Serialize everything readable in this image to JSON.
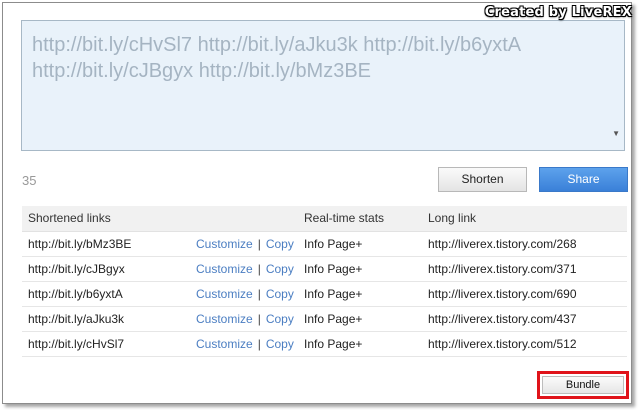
{
  "watermark": "Created by LiveREX",
  "input": {
    "line1": "http://bit.ly/cHvSl7 http://bit.ly/aJku3k http://bit.ly/b6yxtA",
    "line2": "http://bit.ly/cJBgyx http://bit.ly/bMz3BE"
  },
  "char_count": "35",
  "buttons": {
    "shorten": "Shorten",
    "share": "Share",
    "bundle": "Bundle"
  },
  "table": {
    "headers": [
      "Shortened links",
      "Real-time stats",
      "Long link"
    ],
    "actions": {
      "customize": "Customize",
      "separator": "|",
      "copy": "Copy"
    },
    "rows": [
      {
        "short": "http://bit.ly/bMz3BE",
        "stats": "Info Page+",
        "long": "http://liverex.tistory.com/268"
      },
      {
        "short": "http://bit.ly/cJBgyx",
        "stats": "Info Page+",
        "long": "http://liverex.tistory.com/371"
      },
      {
        "short": "http://bit.ly/b6yxtA",
        "stats": "Info Page+",
        "long": "http://liverex.tistory.com/690"
      },
      {
        "short": "http://bit.ly/aJku3k",
        "stats": "Info Page+",
        "long": "http://liverex.tistory.com/437"
      },
      {
        "short": "http://bit.ly/cHvSl7",
        "stats": "Info Page+",
        "long": "http://liverex.tistory.com/512"
      }
    ]
  },
  "colors": {
    "share_blue": "#4a8fe2",
    "highlight_red": "#e0131a",
    "link_blue": "#4b7ec2",
    "input_bg": "#e9f2fa"
  }
}
